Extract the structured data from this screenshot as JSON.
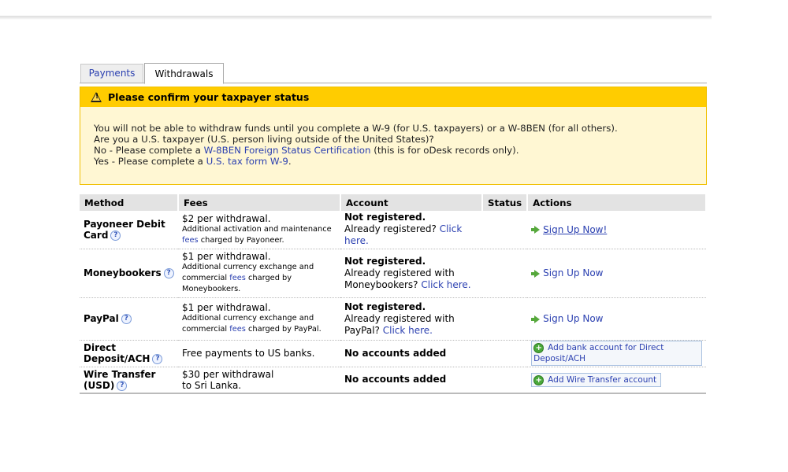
{
  "tabs": {
    "payments": "Payments",
    "withdrawals": "Withdrawals"
  },
  "notice": {
    "title": "Please confirm your taxpayer status",
    "line1": "You will not be able to withdraw funds until you complete a W-9 (for U.S. taxpayers) or a W-8BEN (for all others).",
    "line2": "Are you a U.S. taxpayer (U.S. person living outside of the United States)?",
    "line3_pre": "No - Please complete a ",
    "line3_link": "W-8BEN Foreign Status Certification",
    "line3_post": " (this is for oDesk records only).",
    "line4_pre": "Yes - Please complete a ",
    "line4_link": "U.S. tax form W-9",
    "line4_post": "."
  },
  "table": {
    "headers": {
      "method": "Method",
      "fees": "Fees",
      "account": "Account",
      "status": "Status",
      "actions": "Actions"
    },
    "rows": [
      {
        "method": "Payoneer Debit Card",
        "fee_main": "$2 per withdrawal.",
        "fee_note_pre": "Additional activation and maintenance ",
        "fee_note_link": "fees",
        "fee_note_post": " charged by Payoneer.",
        "acc_status": "Not registered.",
        "acc_pre": "Already registered? ",
        "acc_link": "Click here.",
        "action": "Sign Up Now!"
      },
      {
        "method": "Moneybookers",
        "fee_main": "$1 per withdrawal.",
        "fee_note_pre": "Additional currency exchange and commercial ",
        "fee_note_link": "fees",
        "fee_note_post": " charged by Moneybookers.",
        "acc_status": "Not registered.",
        "acc_pre": "Already registered with Moneybookers? ",
        "acc_link": "Click here.",
        "action": "Sign Up Now"
      },
      {
        "method": "PayPal",
        "fee_main": "$1 per withdrawal.",
        "fee_note_pre": "Additional currency exchange and commercial ",
        "fee_note_link": "fees",
        "fee_note_post": " charged by PayPal.",
        "acc_status": "Not registered.",
        "acc_pre": "Already registered with PayPal? ",
        "acc_link": "Click here.",
        "action": "Sign Up Now"
      },
      {
        "method": "Direct Deposit/ACH",
        "fee_main": "Free payments to US banks.",
        "acc_status": "No accounts added",
        "action": "Add bank account for Direct Deposit/ACH"
      },
      {
        "method": "Wire Transfer (USD)",
        "fee_main": "$30 per withdrawal to Sri Lanka.",
        "acc_status": "No accounts added",
        "action": "Add Wire Transfer account"
      }
    ]
  },
  "icons": {
    "warning": "warning-icon",
    "help": "help-icon",
    "arrow": "arrow-right-icon",
    "add": "add-icon"
  },
  "colors": {
    "notice_header": "#ffcc00",
    "notice_bg": "#fff7d3",
    "link": "#2a3fb0"
  }
}
